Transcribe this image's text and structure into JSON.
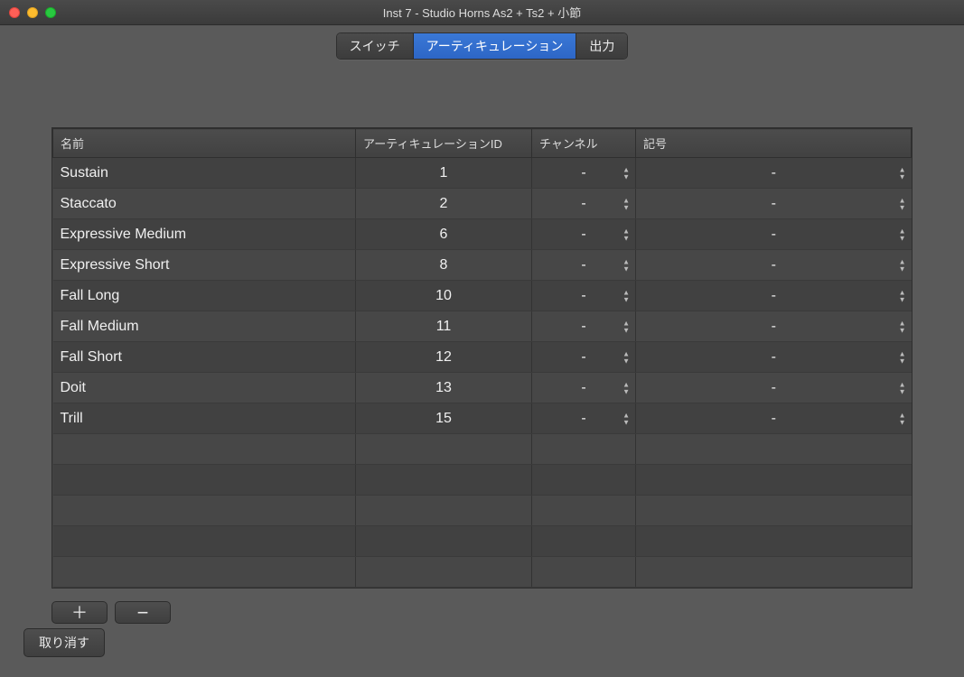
{
  "window": {
    "title": "Inst 7 - Studio Horns As2 + Ts2 + 小節"
  },
  "tabs": {
    "switch": "スイッチ",
    "articulation": "アーティキュレーション",
    "output": "出力"
  },
  "columns": {
    "name": "名前",
    "id": "アーティキュレーションID",
    "channel": "チャンネル",
    "symbol": "記号"
  },
  "rows": [
    {
      "name": "Sustain",
      "id": "1",
      "channel": "-",
      "symbol": "-"
    },
    {
      "name": "Staccato",
      "id": "2",
      "channel": "-",
      "symbol": "-"
    },
    {
      "name": "Expressive Medium",
      "id": "6",
      "channel": "-",
      "symbol": "-"
    },
    {
      "name": "Expressive Short",
      "id": "8",
      "channel": "-",
      "symbol": "-"
    },
    {
      "name": "Fall Long",
      "id": "10",
      "channel": "-",
      "symbol": "-"
    },
    {
      "name": "Fall Medium",
      "id": "11",
      "channel": "-",
      "symbol": "-"
    },
    {
      "name": "Fall Short",
      "id": "12",
      "channel": "-",
      "symbol": "-"
    },
    {
      "name": "Doit",
      "id": "13",
      "channel": "-",
      "symbol": "-"
    },
    {
      "name": "Trill",
      "id": "15",
      "channel": "-",
      "symbol": "-"
    }
  ],
  "buttons": {
    "add": "＋",
    "remove": "−",
    "revert": "取り消す"
  }
}
